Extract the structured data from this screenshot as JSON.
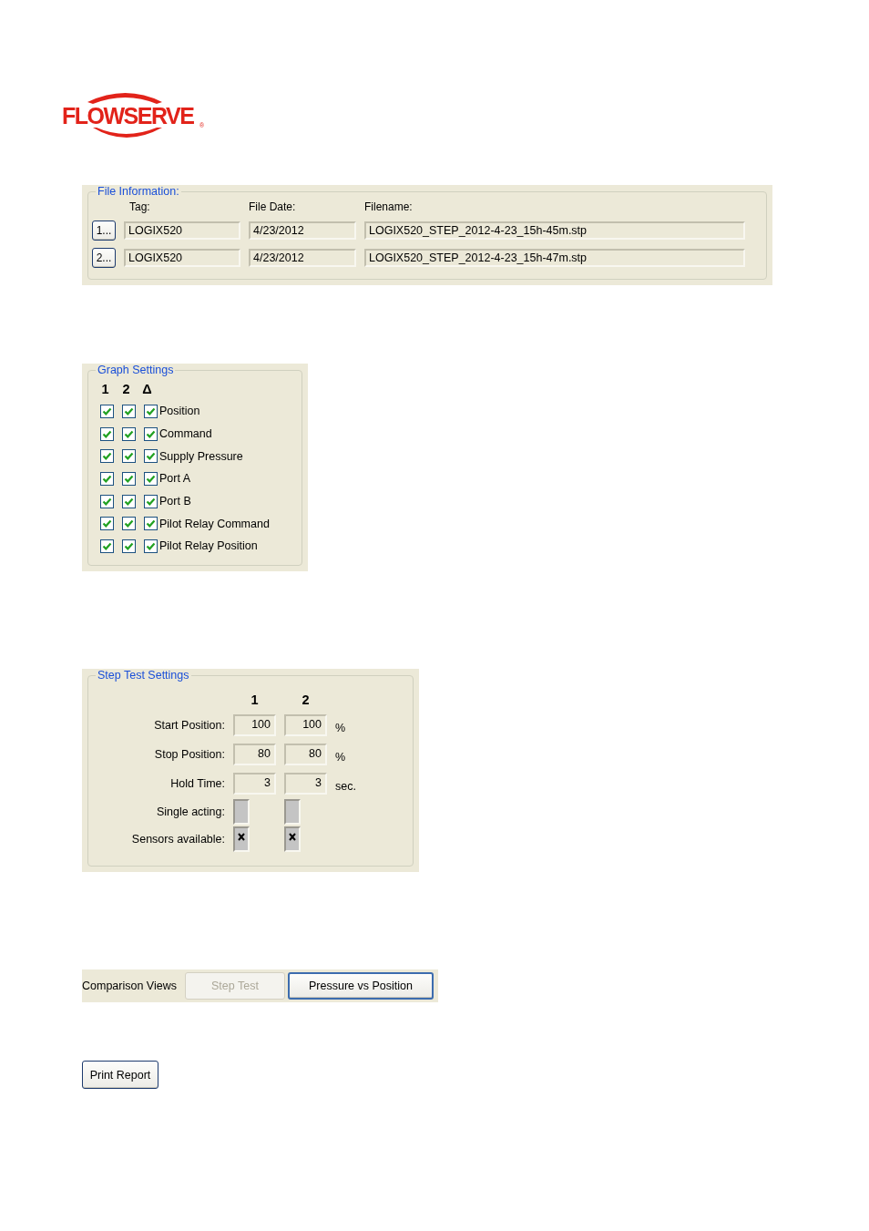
{
  "logo": {
    "name": "FLOWSERVE",
    "mark": "®"
  },
  "file_information": {
    "title": "File Information:",
    "columns": [
      "Tag:",
      "File Date:",
      "Filename:"
    ],
    "rows": [
      {
        "button": "1...",
        "tag": "LOGIX520",
        "date": "4/23/2012",
        "filename": "LOGIX520_STEP_2012-4-23_15h-45m.stp"
      },
      {
        "button": "2...",
        "tag": "LOGIX520",
        "date": "4/23/2012",
        "filename": "LOGIX520_STEP_2012-4-23_15h-47m.stp"
      }
    ]
  },
  "graph_settings": {
    "title": "Graph Settings",
    "columns": [
      "1",
      "2",
      "Δ"
    ],
    "rows": [
      {
        "label": "Position",
        "checked": [
          true,
          true,
          true
        ]
      },
      {
        "label": "Command",
        "checked": [
          true,
          true,
          true
        ]
      },
      {
        "label": "Supply Pressure",
        "checked": [
          true,
          true,
          true
        ]
      },
      {
        "label": "Port A",
        "checked": [
          true,
          true,
          true
        ]
      },
      {
        "label": "Port B",
        "checked": [
          true,
          true,
          true
        ]
      },
      {
        "label": "Pilot Relay Command",
        "checked": [
          true,
          true,
          true
        ]
      },
      {
        "label": "Pilot Relay Position",
        "checked": [
          true,
          true,
          true
        ]
      }
    ]
  },
  "step_test_settings": {
    "title": "Step Test Settings",
    "columns": [
      "1",
      "2"
    ],
    "rows": [
      {
        "kind": "field",
        "label": "Start Position:",
        "values": [
          "100",
          "100"
        ],
        "unit": "%"
      },
      {
        "kind": "field",
        "label": "Stop Position:",
        "values": [
          "80",
          "80"
        ],
        "unit": "%"
      },
      {
        "kind": "field",
        "label": "Hold Time:",
        "values": [
          "3",
          "3"
        ],
        "unit": "sec."
      },
      {
        "kind": "checkbox",
        "label": "Single acting:",
        "checked": [
          false,
          false
        ]
      },
      {
        "kind": "checkbox",
        "label": "Sensors available:",
        "checked": [
          true,
          true
        ]
      }
    ]
  },
  "comparison_views": {
    "label": "Comparison Views",
    "buttons": [
      {
        "label": "Step Test",
        "disabled": true
      },
      {
        "label": "Pressure vs Position",
        "disabled": false
      }
    ]
  },
  "print_button": "Print Report"
}
